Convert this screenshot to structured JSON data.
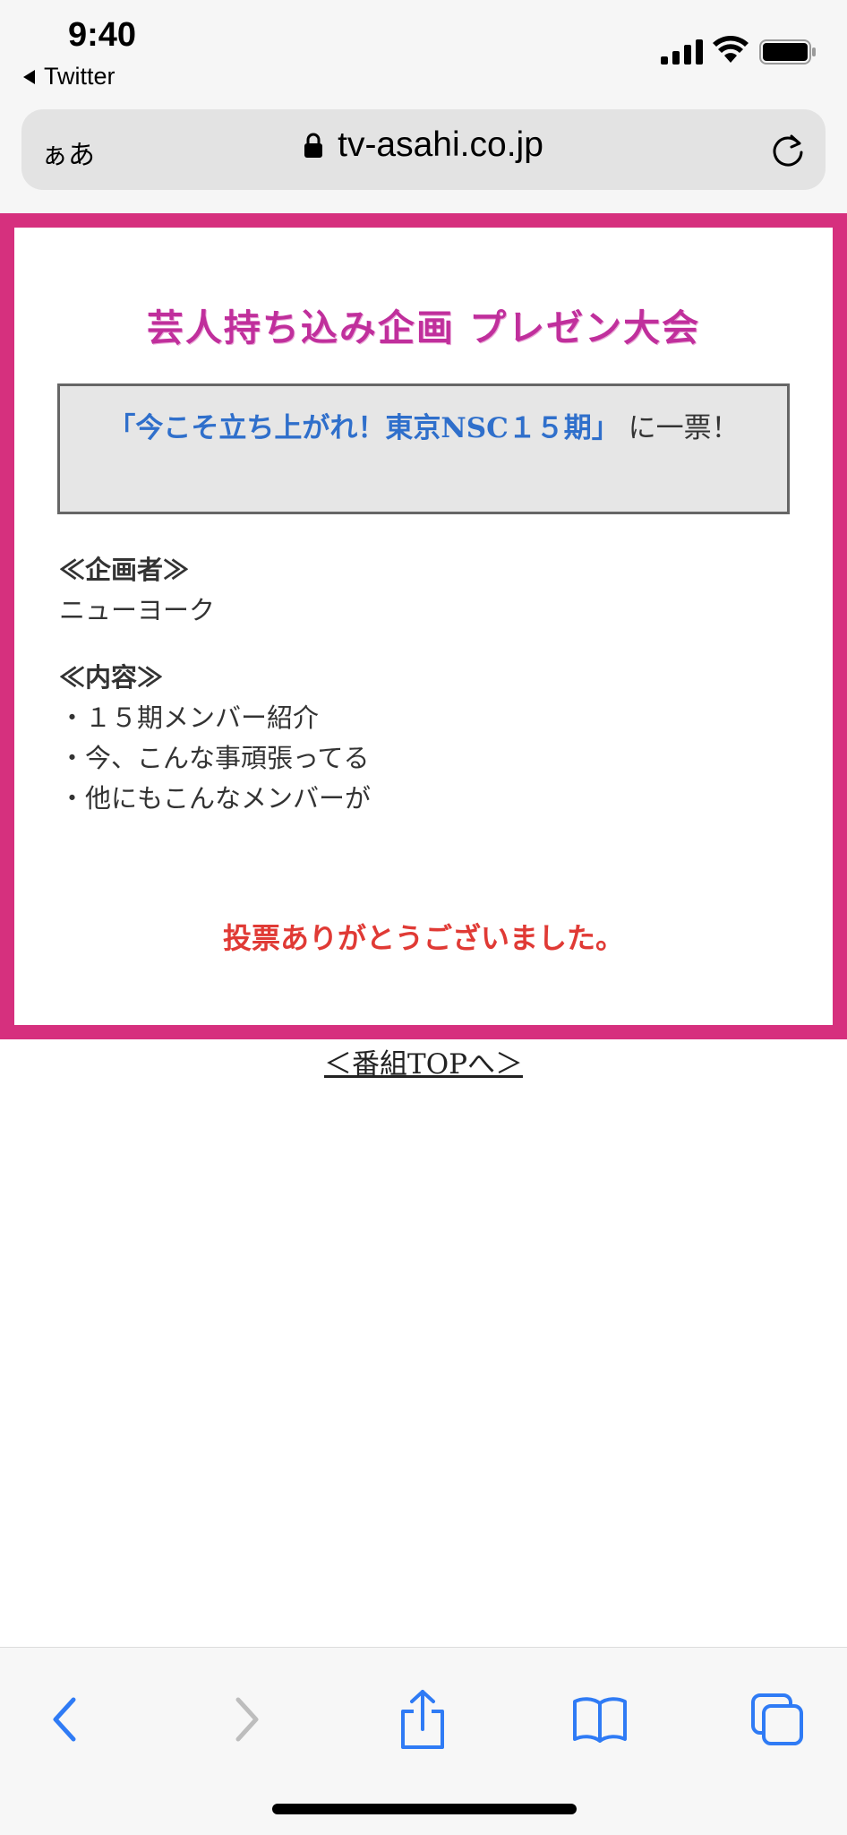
{
  "status_bar": {
    "time": "9:40",
    "back_app": "Twitter"
  },
  "browser": {
    "text_size_button": "ぁあ",
    "url": "tv-asahi.co.jp",
    "icons": [
      "lock-icon",
      "reload-icon",
      "back-arrow-icon",
      "forward-arrow-icon",
      "share-icon",
      "bookmarks-icon",
      "tabs-icon"
    ]
  },
  "page": {
    "banner_title": "芸人持ち込み企画 プレゼン大会",
    "vote": {
      "title": "「今こそ立ち上がれ！東京NSC１５期」",
      "suffix": " に一票！"
    },
    "planner": {
      "heading": "≪企画者≫",
      "name": "ニューヨーク"
    },
    "contents": {
      "heading": "≪内容≫",
      "items": [
        "・１５期メンバー紹介",
        "・今、こんな事頑張ってる",
        "・他にもこんなメンバーが"
      ]
    },
    "thanks_message": "投票ありがとうございました。",
    "top_link": "＜番組TOPへ＞"
  },
  "colors": {
    "frame": "#d6307e",
    "banner": "#c02f9c",
    "vote_title": "#2f6fcb",
    "thanks": "#e03a35",
    "ios_blue": "#2f7bf5"
  }
}
